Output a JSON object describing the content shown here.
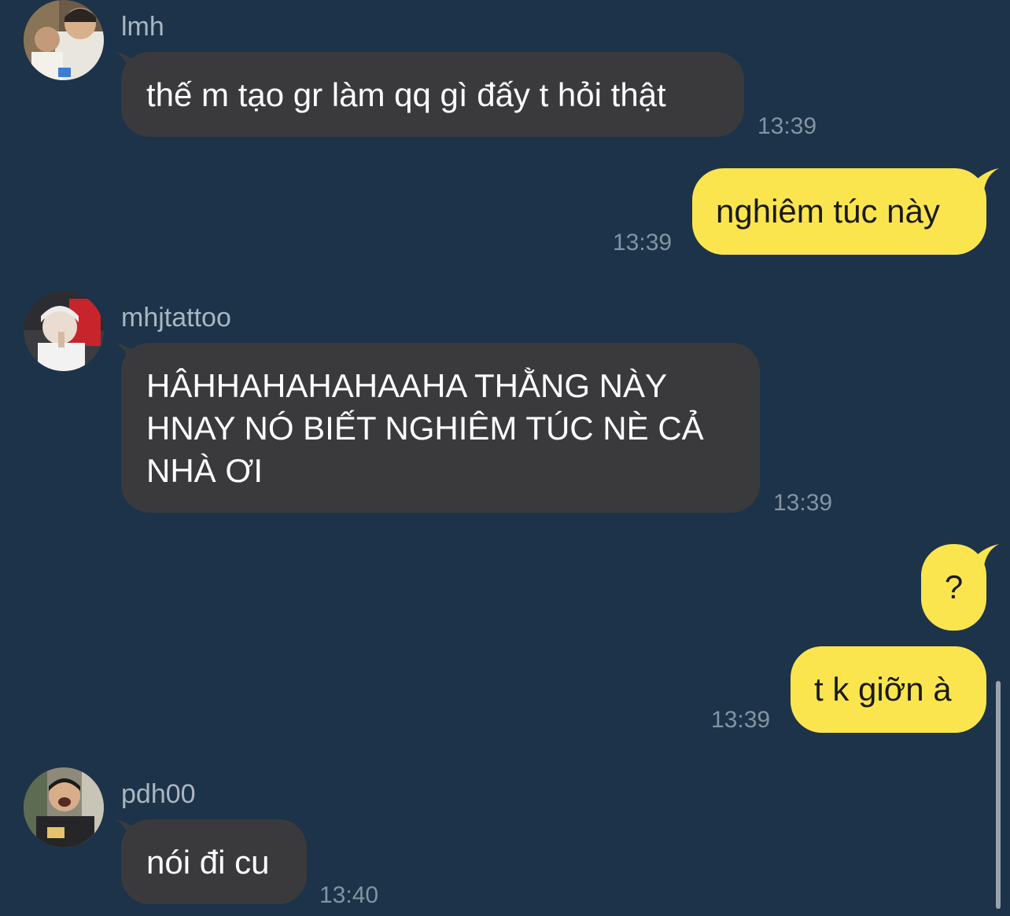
{
  "messages": [
    {
      "sender": "lmh",
      "text": "thế m tạo gr làm qq gì đấy t hỏi thật",
      "time": "13:39"
    },
    {
      "text": "nghiêm túc này",
      "time": "13:39"
    },
    {
      "sender": "mhjtattoo",
      "text": "HÂHHAHAHAHAAHA THẰNG NÀY HNAY NÓ BIẾT NGHIÊM TÚC NÈ CẢ NHÀ ƠI",
      "time": "13:39"
    },
    {
      "text": "?"
    },
    {
      "text": "t k giỡn à",
      "time": "13:39"
    },
    {
      "sender": "pdh00",
      "text": "nói đi cu",
      "time": "13:40"
    }
  ],
  "colors": {
    "background": "#1c3349",
    "incoming_bubble": "#3a3a3c",
    "outgoing_bubble": "#fae54f",
    "sender_name": "#a9b6c2",
    "timestamp": "#8394a4"
  }
}
